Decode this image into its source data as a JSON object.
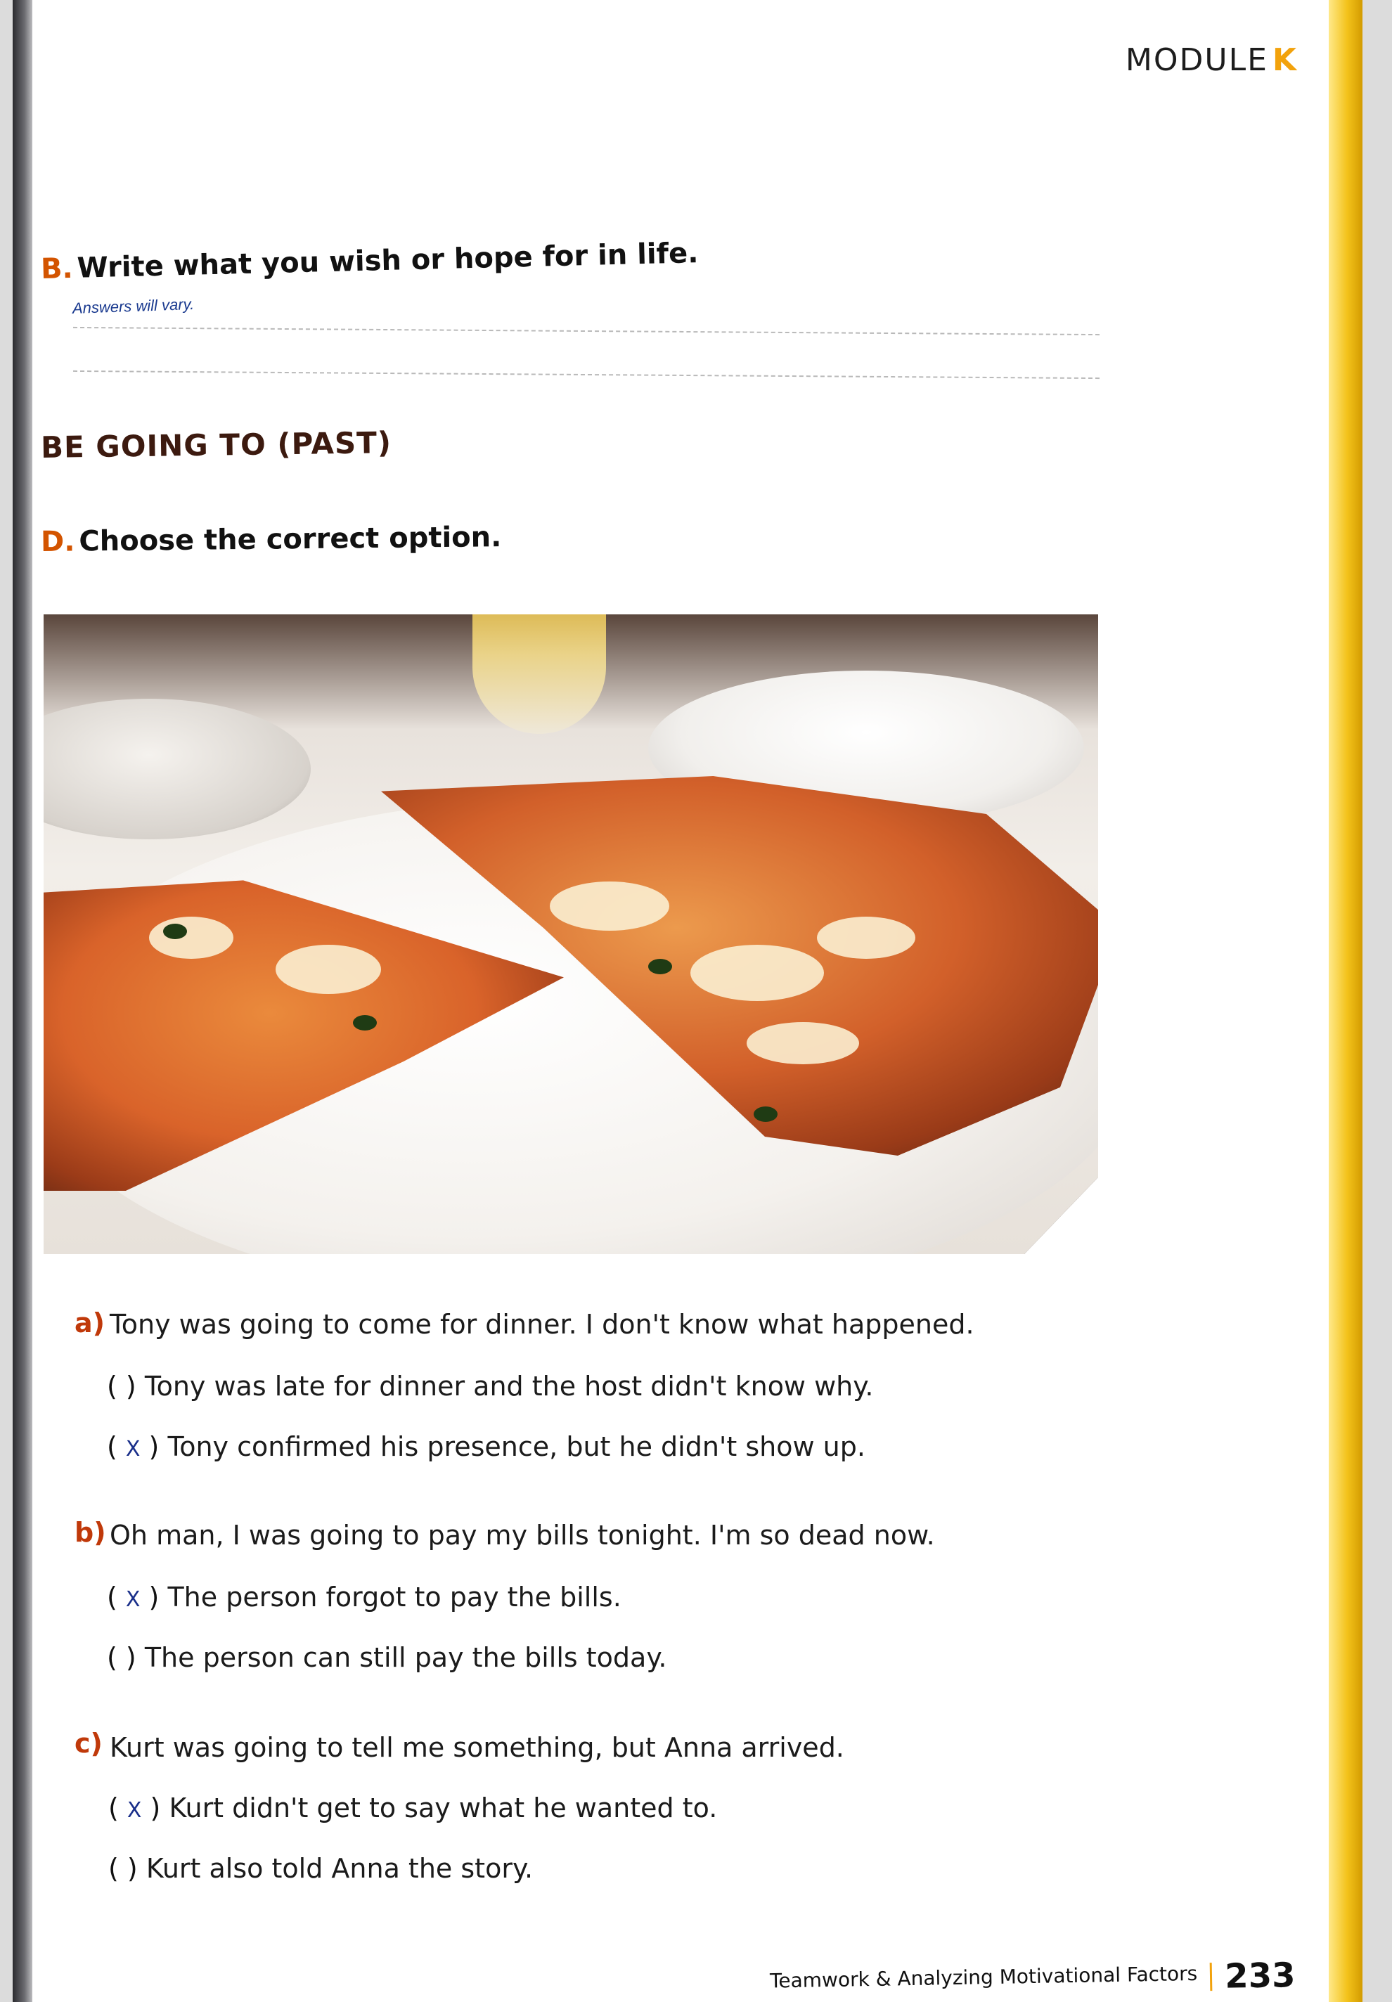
{
  "header": {
    "module_word": "MODULE",
    "module_letter": "K"
  },
  "sectionB": {
    "letter": "B.",
    "prompt": "Write what you wish or hope for in life.",
    "answer_note": "Answers will vary."
  },
  "grammar_title": "BE GOING TO (PAST)",
  "sectionD": {
    "letter": "D.",
    "prompt": "Choose the correct option."
  },
  "questions": [
    {
      "letter": "a)",
      "text": "Tony was going to come for dinner. I don't know what happened.",
      "options": [
        {
          "mark": "",
          "text": "Tony was late for dinner and the host didn't know why."
        },
        {
          "mark": "X",
          "text": "Tony confirmed his presence, but he didn't show up."
        }
      ]
    },
    {
      "letter": "b)",
      "text": "Oh man, I was going to pay my bills tonight. I'm so dead now.",
      "options": [
        {
          "mark": "X",
          "text": "The person forgot to pay the bills."
        },
        {
          "mark": "",
          "text": "The person can still pay the bills today."
        }
      ]
    },
    {
      "letter": "c)",
      "text": "Kurt was going to tell me something, but Anna arrived.",
      "options": [
        {
          "mark": "X",
          "text": "Kurt didn't get to say what he wanted to."
        },
        {
          "mark": "",
          "text": "Kurt also told Anna the story."
        }
      ]
    }
  ],
  "footer": {
    "text": "Teamwork & Analyzing Motivational Factors",
    "page_number": "233"
  },
  "colors": {
    "accent": "#f2a20c",
    "letter": "#c0390a",
    "mark": "#1a2f8a"
  }
}
